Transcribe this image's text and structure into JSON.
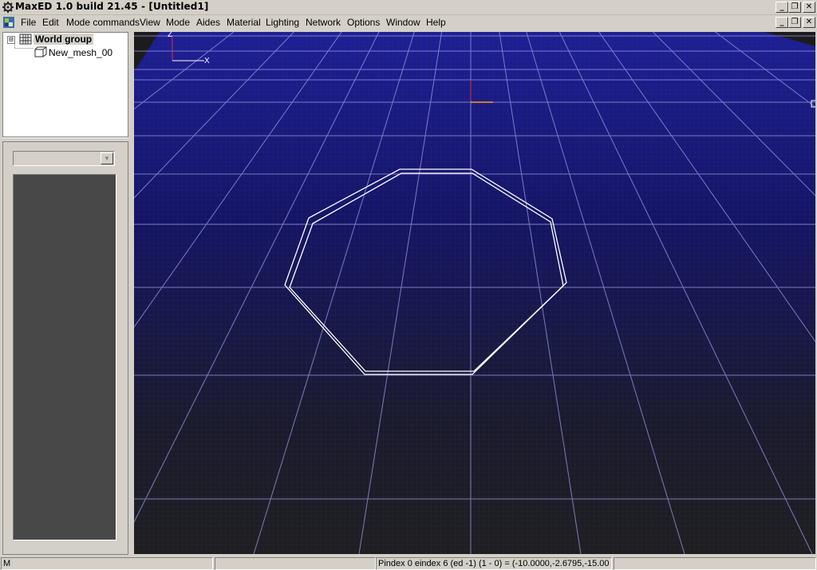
{
  "window": {
    "title": "MaxED 1.0 build 21.45 - [Untitled1]",
    "app_icon": "gear-icon",
    "buttons": {
      "minimize": "_",
      "restore": "❐",
      "close": "✕"
    }
  },
  "menu": {
    "items": [
      "File",
      "Edit",
      "Mode commands",
      "View",
      "Mode",
      "Aides",
      "Material",
      "Lighting",
      "Network",
      "Options",
      "Window",
      "Help"
    ]
  },
  "tree": {
    "root": {
      "label": "World group",
      "expander": "⊟"
    },
    "children": [
      {
        "label": "New_mesh_00"
      }
    ]
  },
  "properties": {
    "combo_value": ""
  },
  "viewport": {
    "axis_label_z": "Z",
    "axis_label_x": "X",
    "background": "#1c1c1c",
    "grid_color": "#8c8cd8",
    "shape": "octagon wireframe"
  },
  "status": {
    "left": "M",
    "middle": "",
    "right": "Pindex 0 eindex 6 (ed -1) (1 - 0) = (-10.0000,-2.6795,-15.00"
  }
}
